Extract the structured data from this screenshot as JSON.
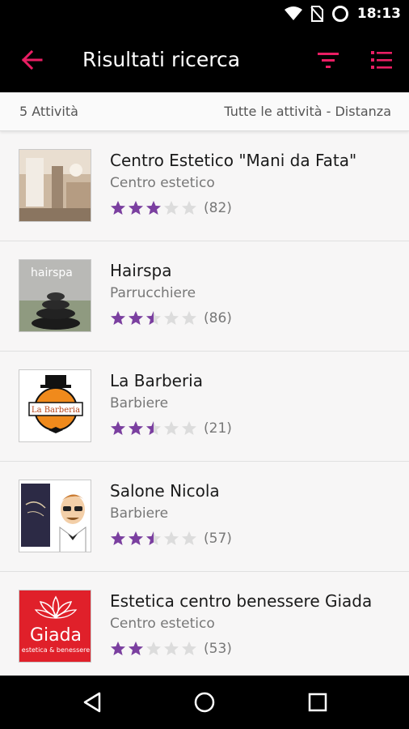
{
  "status_bar": {
    "time": "18:13",
    "icons": [
      "wifi-icon",
      "no-sim-icon",
      "sync-circle-icon"
    ]
  },
  "app_bar": {
    "title": "Risultati ricerca",
    "back_icon": "arrow-back-icon",
    "filter_icon": "filter-icon",
    "sort_icon": "list-sort-icon",
    "accent_color": "#e91e63"
  },
  "summary": {
    "count_label": "5 Attività",
    "sort_label": "Tutte le attività - Distanza"
  },
  "star_colors": {
    "filled": "#7b3fa0",
    "empty": "#dcdcdc"
  },
  "results": [
    {
      "name": "Centro Estetico \"Mani da Fata\"",
      "category": "Centro estetico",
      "rating": 3,
      "reviews": "(82)",
      "image": "salon-interior-photo"
    },
    {
      "name": "Hairspa",
      "category": "Parrucchiere",
      "rating": 2.5,
      "reviews": "(86)",
      "image": "hairspa-logo-stones",
      "logo_text": "hairspa"
    },
    {
      "name": "La Barberia",
      "category": "Barbiere",
      "rating": 2.5,
      "reviews": "(21)",
      "image": "la-barberia-logo",
      "logo_text": "La Barberia"
    },
    {
      "name": "Salone Nicola",
      "category": "Barbiere",
      "rating": 2.5,
      "reviews": "(57)",
      "image": "salone-nicola-illustration"
    },
    {
      "name": "Estetica centro benessere Giada",
      "category": "Centro estetico",
      "rating": 2,
      "reviews": "(53)",
      "image": "giada-logo",
      "logo_text": "Giada",
      "logo_sub": "estetica & benessere"
    }
  ],
  "nav_bar": {
    "back": "nav-back-icon",
    "home": "nav-home-icon",
    "recents": "nav-recents-icon"
  }
}
